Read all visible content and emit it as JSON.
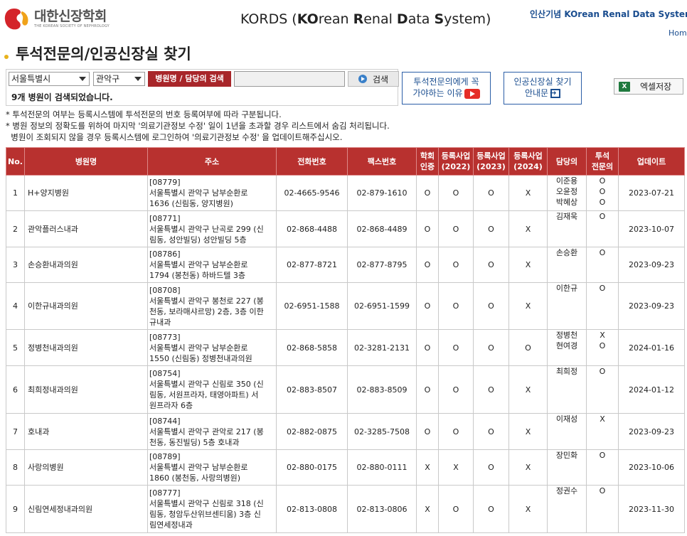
{
  "header": {
    "logo_title": "대한신장학회",
    "logo_sub": "THE KOREAN SOCIETY OF NEPHROLOGY",
    "center_title_parts": [
      "KO",
      "rean ",
      "R",
      "enal ",
      "D",
      "ata ",
      "S",
      "ystem)"
    ],
    "center_title_prefix": "KORDS (",
    "right_title": "인산기념 KOrean Renal Data System",
    "home_link": "Home"
  },
  "page_title": "투석전문의/인공신장실 찾기",
  "search": {
    "city": "서울특별시",
    "district": "관악구",
    "label": "병원명 / 담당의 검색",
    "input_value": "",
    "button": "검색",
    "result_count": "9개 병원이 검색되었습니다."
  },
  "buttons": {
    "why_line1": "투석전문의에게 꼭",
    "why_line2": "가야하는 이유",
    "guide_line1": "인공신장실 찾기",
    "guide_line2": "안내문",
    "excel": "엑셀저장",
    "excel_icon": "X"
  },
  "notes": [
    "* 투석전문의 여부는 등록시스템에 투석전문의 번호 등록여부에 따라 구분됩니다.",
    "* 병원 정보의 정확도를 위하여 마지막 '의료기관정보 수정' 일이 1년을 초과할 경우 리스트에서 숨김 처리됩니다.",
    "  병원이 조회되지 않을 경우 등록시스템에 로그인하여 '의료기관정보 수정' 을 업데이트해주십시오."
  ],
  "table": {
    "headers": [
      "No.",
      "병원명",
      "주소",
      "전화번호",
      "팩스번호",
      "학회\n인증",
      "등록사업\n(2022)",
      "등록사업\n(2023)",
      "등록사업\n(2024)",
      "담당의",
      "투석\n전문의",
      "업데이트"
    ],
    "rows": [
      {
        "no": "1",
        "name": "H+양지병원",
        "addr": [
          "[08779]",
          "서울특별시 관악구 남부순환로",
          "1636 (신림동, 양지병원)"
        ],
        "tel": "02-4665-9546",
        "fax": "02-879-1610",
        "cert": "O",
        "r2022": "O",
        "r2023": "O",
        "r2024": "X",
        "doctors": [
          "이준용",
          "오윤정",
          "박혜상"
        ],
        "specialist": [
          "O",
          "O",
          "O"
        ],
        "updated": "2023-07-21"
      },
      {
        "no": "2",
        "name": "관악플러스내과",
        "addr": [
          "[08771]",
          "서울특별시 관악구 난곡로 299 (신",
          "림동, 성안빌딩) 성안빌딩 5층"
        ],
        "tel": "02-868-4488",
        "fax": "02-868-4489",
        "cert": "O",
        "r2022": "O",
        "r2023": "O",
        "r2024": "X",
        "doctors": [
          "김재욱"
        ],
        "specialist": [
          "O"
        ],
        "updated": "2023-10-07"
      },
      {
        "no": "3",
        "name": "손승환내과의원",
        "addr": [
          "[08786]",
          "서울특별시 관악구 남부순환로",
          "1794 (봉천동) 하바드텔 3층"
        ],
        "tel": "02-877-8721",
        "fax": "02-877-8795",
        "cert": "O",
        "r2022": "O",
        "r2023": "O",
        "r2024": "X",
        "doctors": [
          "손승환"
        ],
        "specialist": [
          "O"
        ],
        "updated": "2023-09-23"
      },
      {
        "no": "4",
        "name": "이한규내과의원",
        "addr": [
          "[08708]",
          "서울특별시 관악구 봉천로 227 (봉",
          "천동, 보라매샤르망) 2층, 3층 이한",
          "규내과"
        ],
        "tel": "02-6951-1588",
        "fax": "02-6951-1599",
        "cert": "O",
        "r2022": "O",
        "r2023": "O",
        "r2024": "X",
        "doctors": [
          "이한규"
        ],
        "specialist": [
          "O"
        ],
        "updated": "2023-09-23"
      },
      {
        "no": "5",
        "name": "정병천내과의원",
        "addr": [
          "[08773]",
          "서울특별시 관악구 남부순환로",
          "1550 (신림동) 정병천내과의원"
        ],
        "tel": "02-868-5858",
        "fax": "02-3281-2131",
        "cert": "O",
        "r2022": "O",
        "r2023": "O",
        "r2024": "O",
        "doctors": [
          "정병천",
          "현여경"
        ],
        "specialist": [
          "X",
          "O"
        ],
        "updated": "2024-01-16"
      },
      {
        "no": "6",
        "name": "최희정내과의원",
        "addr": [
          "[08754]",
          "서울특별시 관악구 신림로 350 (신",
          "림동, 서원프라자, 태영아파트) 서",
          "원프라자 6층"
        ],
        "tel": "02-883-8507",
        "fax": "02-883-8509",
        "cert": "O",
        "r2022": "O",
        "r2023": "O",
        "r2024": "X",
        "doctors": [
          "최희정"
        ],
        "specialist": [
          "O"
        ],
        "updated": "2024-01-12"
      },
      {
        "no": "7",
        "name": "호내과",
        "addr": [
          "[08744]",
          "서울특별시 관악구 관악로 217 (봉",
          "천동, 동진빌딩) 5층 호내과"
        ],
        "tel": "02-882-0875",
        "fax": "02-3285-7508",
        "cert": "O",
        "r2022": "O",
        "r2023": "O",
        "r2024": "X",
        "doctors": [
          "이재성"
        ],
        "specialist": [
          "X"
        ],
        "updated": "2023-09-23"
      },
      {
        "no": "8",
        "name": "사랑의병원",
        "addr": [
          "[08789]",
          "서울특별시 관악구 남부순환로",
          "1860 (봉천동, 사랑의병원)"
        ],
        "tel": "02-880-0175",
        "fax": "02-880-0111",
        "cert": "X",
        "r2022": "X",
        "r2023": "O",
        "r2024": "X",
        "doctors": [
          "장민화"
        ],
        "specialist": [
          "O"
        ],
        "updated": "2023-10-06"
      },
      {
        "no": "9",
        "name": "신림연세정내과의원",
        "addr": [
          "[08777]",
          "서울특별시 관악구 신림로 318 (신",
          "림동, 청암두산위브센티움) 3층 신",
          "림연세정내과"
        ],
        "tel": "02-813-0808",
        "fax": "02-813-0806",
        "cert": "X",
        "r2022": "O",
        "r2023": "O",
        "r2024": "X",
        "doctors": [
          "정권수"
        ],
        "specialist": [
          "O"
        ],
        "updated": "2023-11-30"
      }
    ]
  },
  "colors": {
    "header_red": "#b8312f",
    "label_red": "#a8262a",
    "link_blue": "#1a4d8f"
  }
}
